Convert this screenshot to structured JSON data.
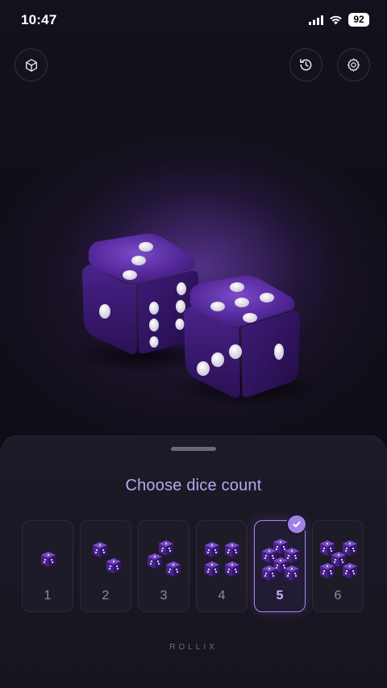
{
  "status_bar": {
    "time": "10:47",
    "battery": "92"
  },
  "top_bar": {
    "left_icon": "cube-icon",
    "history_icon": "history-icon",
    "settings_icon": "gear-icon"
  },
  "scene": {
    "dice": [
      3,
      5
    ]
  },
  "sheet": {
    "title": "Choose dice count",
    "options": [
      {
        "label": "1",
        "count": 1,
        "selected": false
      },
      {
        "label": "2",
        "count": 2,
        "selected": false
      },
      {
        "label": "3",
        "count": 3,
        "selected": false
      },
      {
        "label": "4",
        "count": 4,
        "selected": false
      },
      {
        "label": "5",
        "count": 5,
        "selected": true
      },
      {
        "label": "6",
        "count": 6,
        "selected": false
      }
    ],
    "brand": "ROLLIX"
  },
  "colors": {
    "accent": "#a98ae8",
    "title": "#b8a8f0",
    "dice_purple": "#4a228a"
  }
}
